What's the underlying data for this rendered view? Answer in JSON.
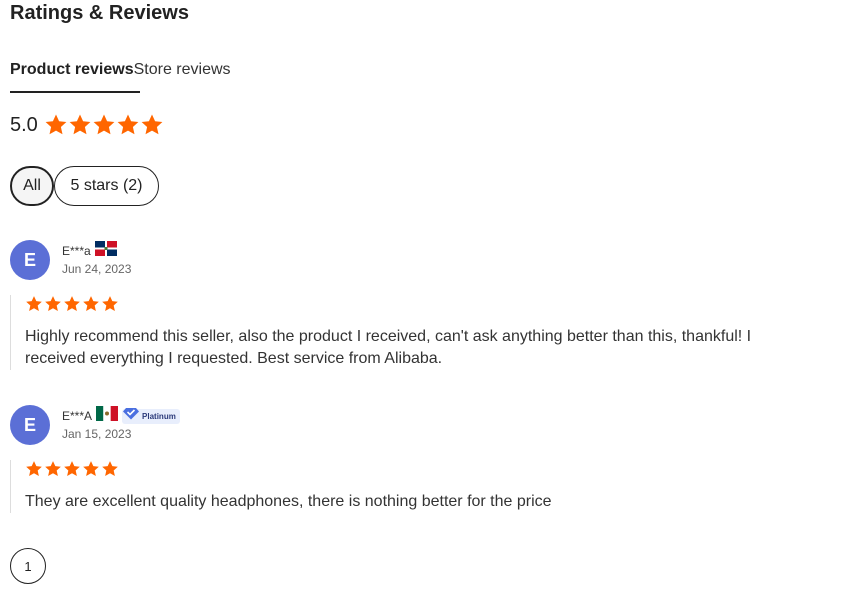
{
  "header": {
    "title": "Ratings & Reviews"
  },
  "tabs": [
    {
      "label": "Product reviews",
      "active": true
    },
    {
      "label": "Store reviews",
      "active": false
    }
  ],
  "summary": {
    "rating": "5.0",
    "stars": 5
  },
  "filters": [
    {
      "label": "All",
      "selected": true
    },
    {
      "label": "5 stars (2)",
      "selected": false
    }
  ],
  "reviews": [
    {
      "initial": "E",
      "name": "E***a",
      "flag": "dominican-republic-flag-icon",
      "date": "Jun 24, 2023",
      "rating": 5,
      "text": "Highly recommend this seller, also the product I received, can't ask anything better than this, thankful! I received everything I requested. Best service from Alibaba."
    },
    {
      "initial": "E",
      "name": "E***A",
      "flag": "mexico-flag-icon",
      "badge": "Platinum",
      "date": "Jan 15, 2023",
      "rating": 5,
      "text": "They are excellent quality headphones, there is nothing better for the price"
    }
  ],
  "pagination": {
    "current": "1"
  },
  "colors": {
    "star": "#ff6600",
    "avatar": "#5b6fd6",
    "text": "#222222"
  }
}
